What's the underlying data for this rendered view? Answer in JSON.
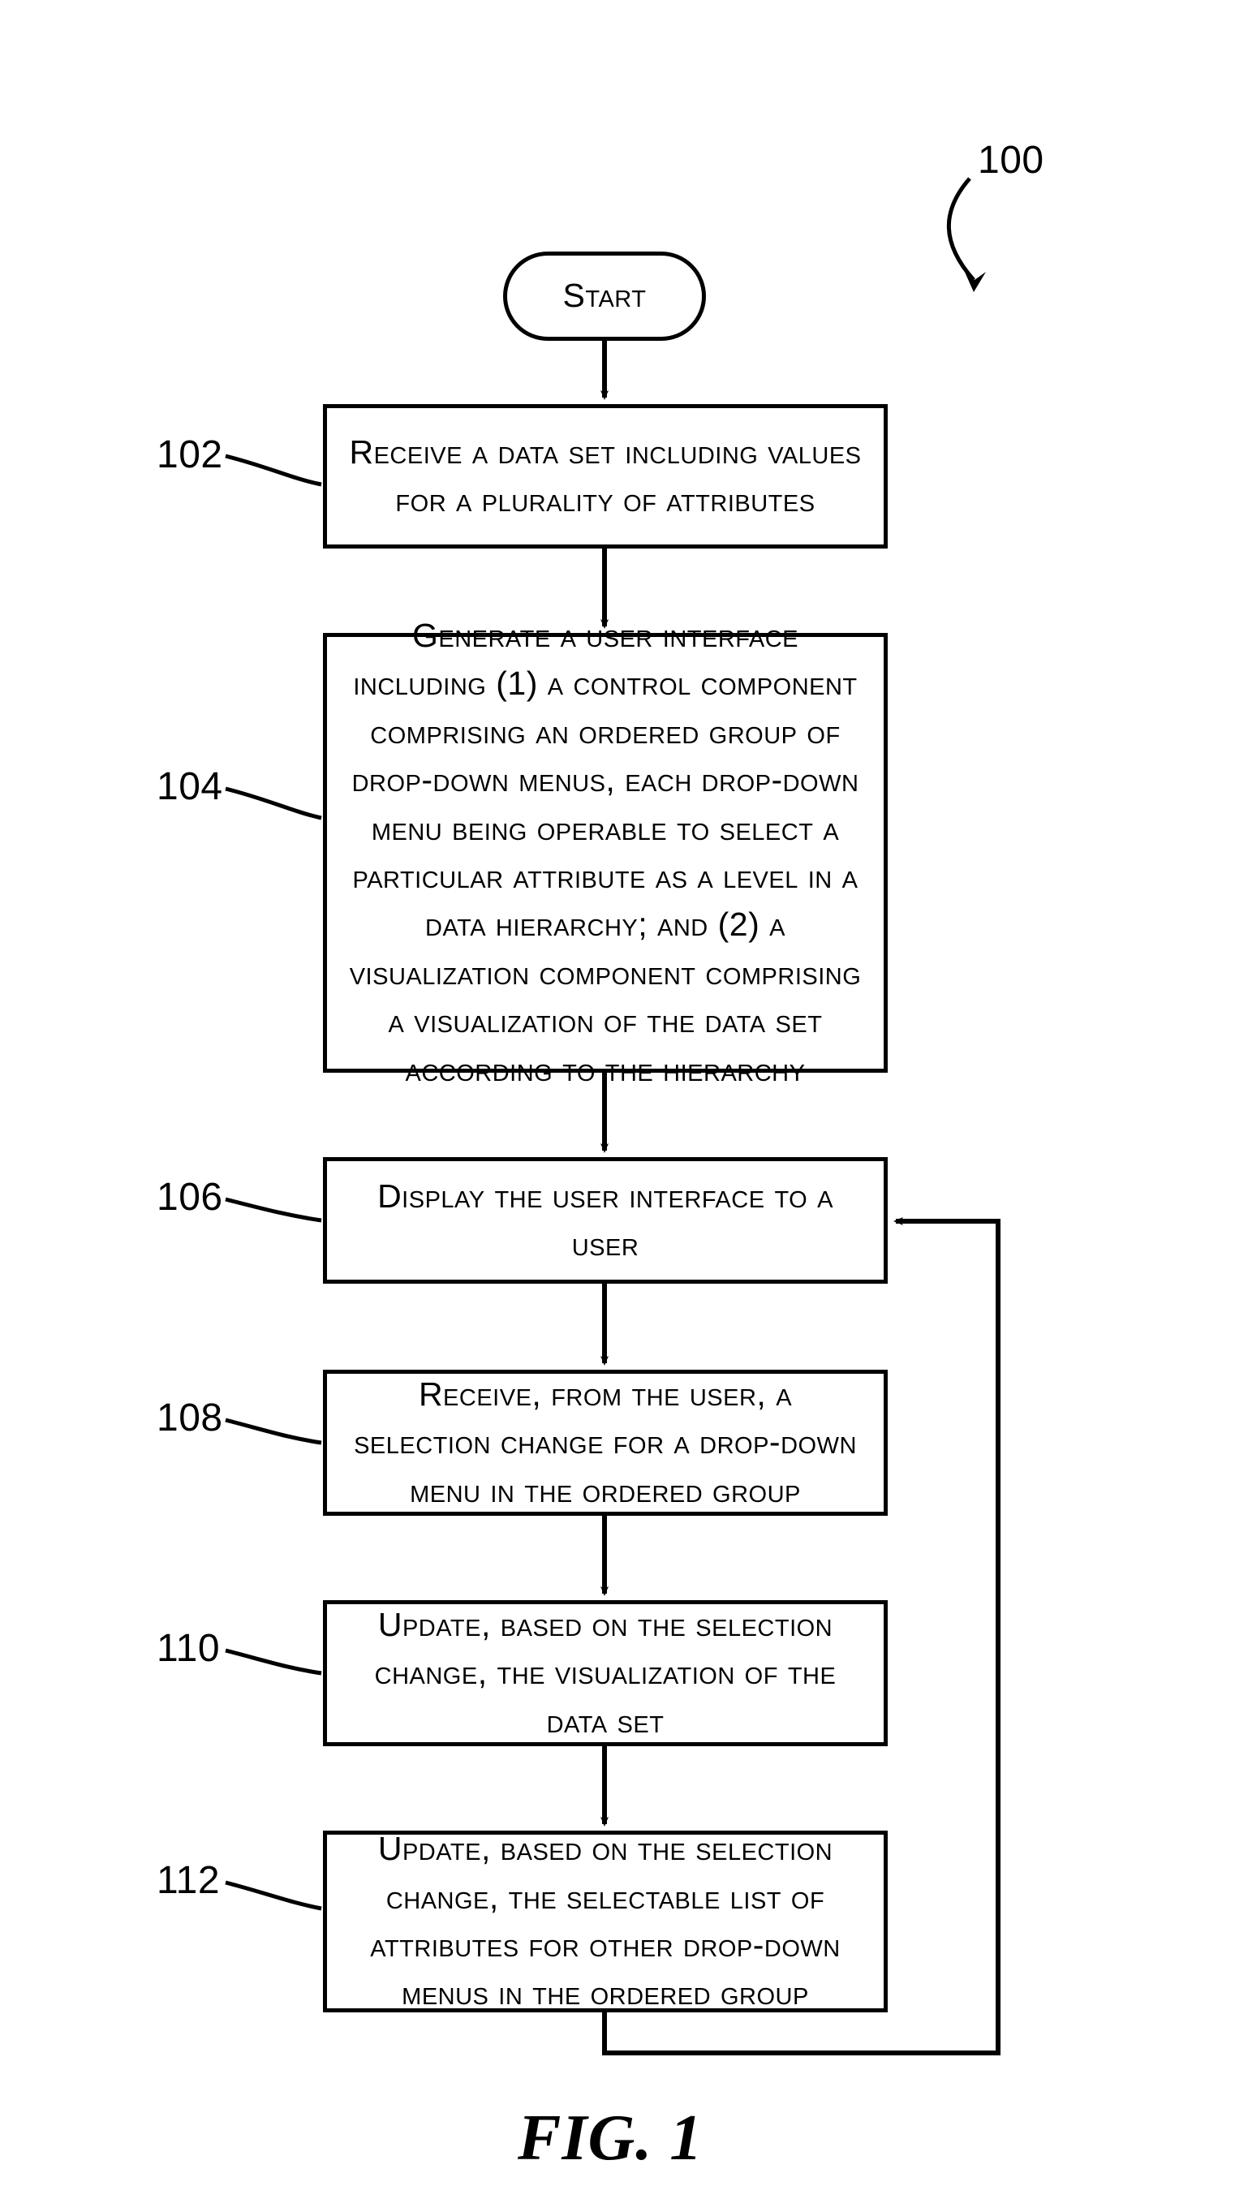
{
  "diagram_ref": "100",
  "start_label": "Start",
  "caption": "FIG. 1",
  "steps": [
    {
      "ref": "102",
      "text": "Receive a data set including values for a plurality of attributes"
    },
    {
      "ref": "104",
      "text": "Generate a user interface including (1) a control component comprising an ordered group of drop-down menus, each drop-down menu being operable to select a particular attribute as a level in a data hierarchy; and (2) a visualization component comprising a visualization of the data set according to the hierarchy"
    },
    {
      "ref": "106",
      "text": "Display the user interface to a user"
    },
    {
      "ref": "108",
      "text": "Receive, from the user, a selection change for a drop-down menu in the ordered group"
    },
    {
      "ref": "110",
      "text": "Update, based on the selection change, the visualization of the data set"
    },
    {
      "ref": "112",
      "text": "Update, based on the selection change, the selectable list of attributes for other drop-down menus in the ordered group"
    }
  ]
}
